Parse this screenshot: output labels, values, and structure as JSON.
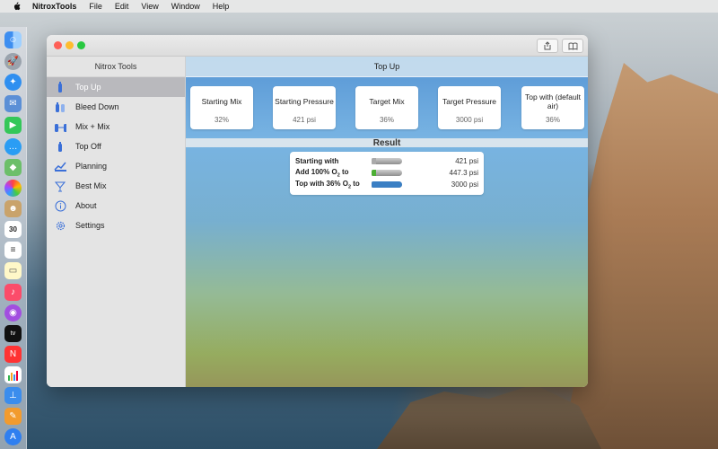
{
  "menubar": {
    "app_name": "NitroxTools",
    "items": [
      "File",
      "Edit",
      "View",
      "Window",
      "Help"
    ]
  },
  "dock": {
    "items": [
      "finder-icon",
      "launchpad-icon",
      "safari-icon",
      "mail-icon",
      "facetime-icon",
      "messages-icon",
      "maps-icon",
      "photos-icon",
      "contacts-icon",
      "calendar-icon",
      "reminders-icon",
      "notes-icon",
      "music-icon",
      "podcasts-icon",
      "tv-icon",
      "news-icon",
      "numbers-icon",
      "keynote-icon",
      "pages-icon",
      "app-store-icon"
    ],
    "calendar_day": "30",
    "tv_label": "tv"
  },
  "sidebar": {
    "title": "Nitrox Tools",
    "items": [
      {
        "label": "Top Up",
        "icon": "tank-icon",
        "selected": true
      },
      {
        "label": "Bleed Down",
        "icon": "bleed-icon",
        "selected": false
      },
      {
        "label": "Mix + Mix",
        "icon": "mix-icon",
        "selected": false
      },
      {
        "label": "Top Off",
        "icon": "top-off-icon",
        "selected": false
      },
      {
        "label": "Planning",
        "icon": "planning-icon",
        "selected": false
      },
      {
        "label": "Best Mix",
        "icon": "best-mix-icon",
        "selected": false
      },
      {
        "label": "About",
        "icon": "info-icon",
        "selected": false
      },
      {
        "label": "Settings",
        "icon": "gear-icon",
        "selected": false
      }
    ]
  },
  "main": {
    "title": "Top Up",
    "cards": [
      {
        "title": "Starting Mix",
        "value": "32%"
      },
      {
        "title": "Starting Pressure",
        "value": "421 psi"
      },
      {
        "title": "Target Mix",
        "value": "36%"
      },
      {
        "title": "Target Pressure",
        "value": "3000 psi"
      },
      {
        "title": "Top with (default air)",
        "value": "36%"
      }
    ],
    "result_title": "Result",
    "result_rows": [
      {
        "label_main": "Starting with",
        "label_sub": "",
        "label_tail": "",
        "value": "421 psi",
        "fill_color": "#aaaaaa",
        "fill_fraction": 0.14
      },
      {
        "label_main": "Add 100% O",
        "label_sub": "2",
        "label_tail": " to",
        "value": "447.3 psi",
        "fill_color": "#4caf34",
        "fill_fraction": 0.15
      },
      {
        "label_main": "Top with 36% O",
        "label_sub": "2",
        "label_tail": " to",
        "value": "3000 psi",
        "fill_color": "#3a7fc4",
        "fill_fraction": 1.0
      }
    ]
  },
  "colors": {
    "selected_row": "#b9b9bd",
    "sidebar_bg": "#e4e4e4",
    "traffic_close": "#fe5f57",
    "traffic_min": "#febc2e",
    "traffic_max": "#28c840"
  }
}
